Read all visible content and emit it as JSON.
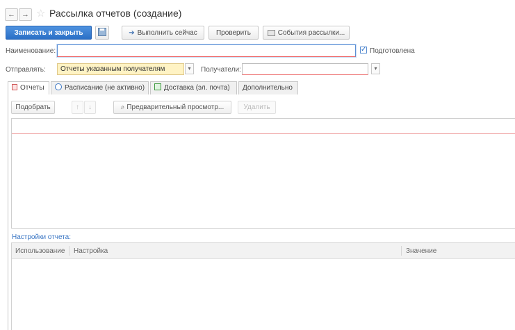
{
  "window": {
    "title": "Рассылка отчетов (создание)",
    "back_icon": "←",
    "forward_icon": "→",
    "favorite_icon": "☆"
  },
  "toolbar": {
    "save_close": "Записать и закрыть",
    "run_now": "Выполнить сейчас",
    "check": "Проверить",
    "events": "События рассылки..."
  },
  "form": {
    "name_label": "Наименование:",
    "name_value": "",
    "prepared_label": "Подготовлена",
    "prepared_checked": true,
    "send_label": "Отправлять:",
    "send_value": "Отчеты указанным получателям",
    "recipients_label": "Получатели:",
    "recipients_value": ""
  },
  "tabs": [
    {
      "label": "Отчеты",
      "active": true,
      "icon": "report-icon"
    },
    {
      "label": "Расписание (не активно)",
      "active": false,
      "icon": "clock-icon"
    },
    {
      "label": "Доставка (эл. почта)",
      "active": false,
      "icon": "delivery-icon"
    },
    {
      "label": "Дополнительно",
      "active": false,
      "icon": ""
    }
  ],
  "reports_panel": {
    "pick": "Подобрать",
    "move_up_icon": "↑",
    "move_down_icon": "↓",
    "preview": "Предварительный просмотр...",
    "delete": "Удалить"
  },
  "settings": {
    "section_label": "Настройки отчета:",
    "columns": [
      "Использование",
      "Настройка",
      "Значение"
    ]
  },
  "colors": {
    "accent": "#2a6fc6",
    "select_bg": "#fff3c4",
    "required_line": "#ee7b7b"
  }
}
